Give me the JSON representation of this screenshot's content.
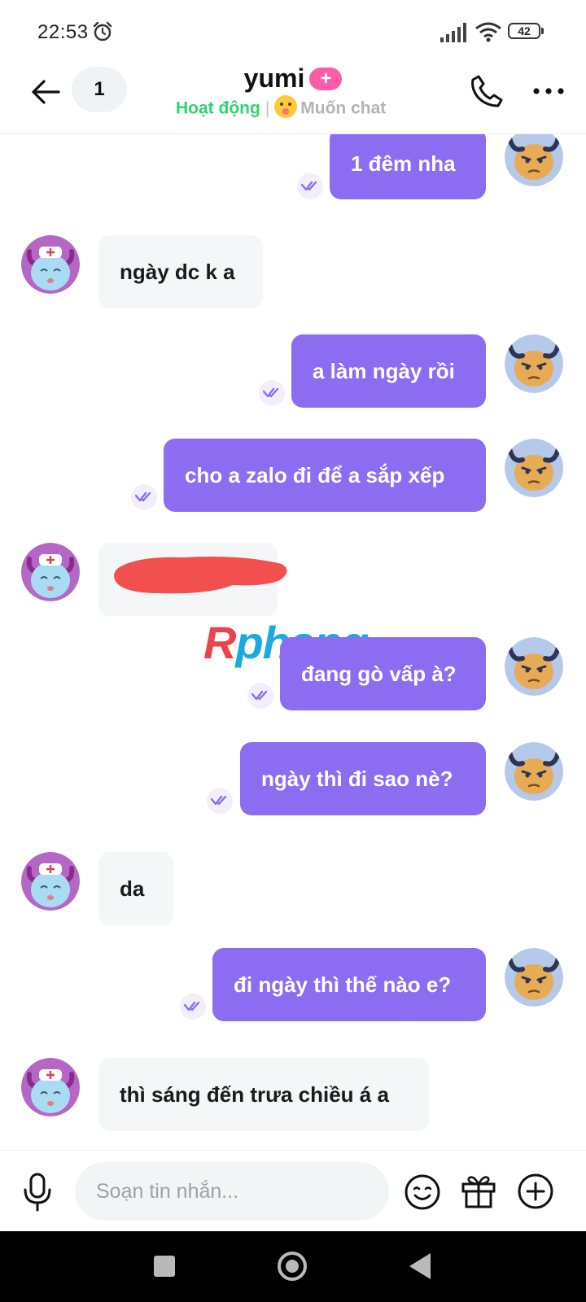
{
  "status_bar": {
    "time": "22:53",
    "battery": "42",
    "icons": [
      "alarm-icon",
      "signal-icon",
      "wifi-icon",
      "battery-icon"
    ]
  },
  "header": {
    "unread_count": "1",
    "title": "yumi",
    "badge": "+",
    "status": "Hoạt động",
    "separator": "|",
    "mood": "Muốn chat",
    "accent_color": "#8c6cf0",
    "online_color": "#2fd46e"
  },
  "messages": [
    {
      "dir": "out",
      "text": "1 đêm nha"
    },
    {
      "dir": "in",
      "text": "ngày dc k a"
    },
    {
      "dir": "out",
      "text": "a làm ngày rồi"
    },
    {
      "dir": "out",
      "text": "cho a zalo đi để a sắp xếp"
    },
    {
      "dir": "in",
      "text": "",
      "redacted": true
    },
    {
      "dir": "out",
      "text": "đang gò vấp à?"
    },
    {
      "dir": "out",
      "text": "ngày thì đi sao nè?"
    },
    {
      "dir": "in",
      "text": "da"
    },
    {
      "dir": "out",
      "text": "đi ngày thì thế nào e?"
    },
    {
      "dir": "in",
      "text": "thì sáng đến trưa chiều á a"
    }
  ],
  "watermark": {
    "first": "R",
    "rest": "phang"
  },
  "composer": {
    "placeholder": "Soạn tin nhắn...",
    "icons": [
      "mic-icon",
      "emoji-icon",
      "gift-icon",
      "add-icon"
    ]
  },
  "nav": {
    "icons": [
      "recent-apps-icon",
      "home-icon",
      "back-icon"
    ]
  }
}
